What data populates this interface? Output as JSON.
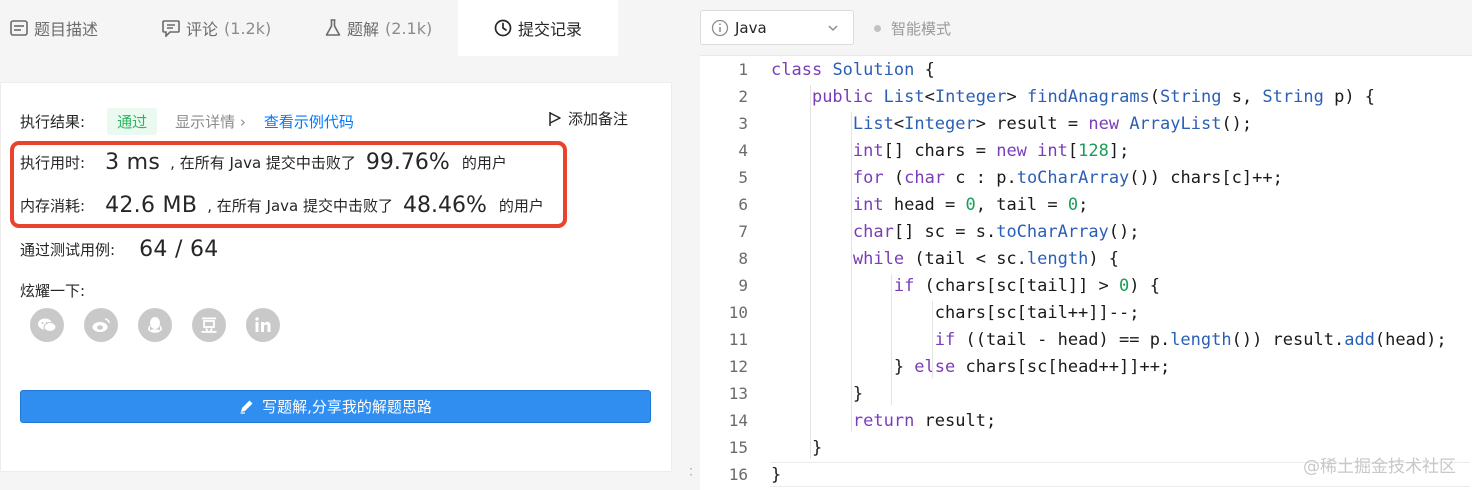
{
  "tabs": [
    {
      "label": "题目描述",
      "count": "",
      "icon": "document-icon"
    },
    {
      "label": "评论",
      "count": "(1.2k)",
      "icon": "comment-icon"
    },
    {
      "label": "题解",
      "count": "(2.1k)",
      "icon": "flask-icon"
    },
    {
      "label": "提交记录",
      "count": "",
      "icon": "clock-icon"
    }
  ],
  "result": {
    "label": "执行结果:",
    "status": "通过",
    "detail": "显示详情 ›",
    "sample": "查看示例代码",
    "note": "添加备注"
  },
  "runtime": {
    "label": "执行用时:",
    "value": "3 ms",
    "mid": ", 在所有 Java 提交中击败了",
    "percent": "99.76%",
    "suffix": "的用户"
  },
  "memory": {
    "label": "内存消耗:",
    "value": "42.6 MB",
    "mid": ", 在所有 Java 提交中击败了",
    "percent": "48.46%",
    "suffix": "的用户"
  },
  "tests": {
    "label": "通过测试用例:",
    "value": "64 / 64"
  },
  "share": {
    "label": "炫耀一下:",
    "icons": [
      "wechat-icon",
      "weibo-icon",
      "qq-icon",
      "douban-icon",
      "linkedin-icon"
    ]
  },
  "write_button": "写题解,分享我的解题思路",
  "editor": {
    "language": "Java",
    "mode": "智能模式"
  },
  "watermark": "@稀土掘金技术社区",
  "code_lines": [
    "class Solution {",
    "    public List<Integer> findAnagrams(String s, String p) {",
    "        List<Integer> result = new ArrayList();",
    "        int[] chars = new int[128];",
    "        for (char c : p.toCharArray()) chars[c]++;",
    "        int head = 0, tail = 0;",
    "        char[] sc = s.toCharArray();",
    "        while (tail < sc.length) {",
    "            if (chars[sc[tail]] > 0) {",
    "                chars[sc[tail++]]--;",
    "                if ((tail - head) == p.length()) result.add(head);",
    "            } else chars[sc[head++]]++;",
    "        }",
    "        return result;",
    "    }",
    "}"
  ],
  "colors": {
    "accent": "#2f8ef0",
    "pass": "#2db55d",
    "highlight": "#e8432c",
    "keyword": "#7a3db8",
    "type": "#2b5fb5",
    "number": "#1a9d58"
  }
}
